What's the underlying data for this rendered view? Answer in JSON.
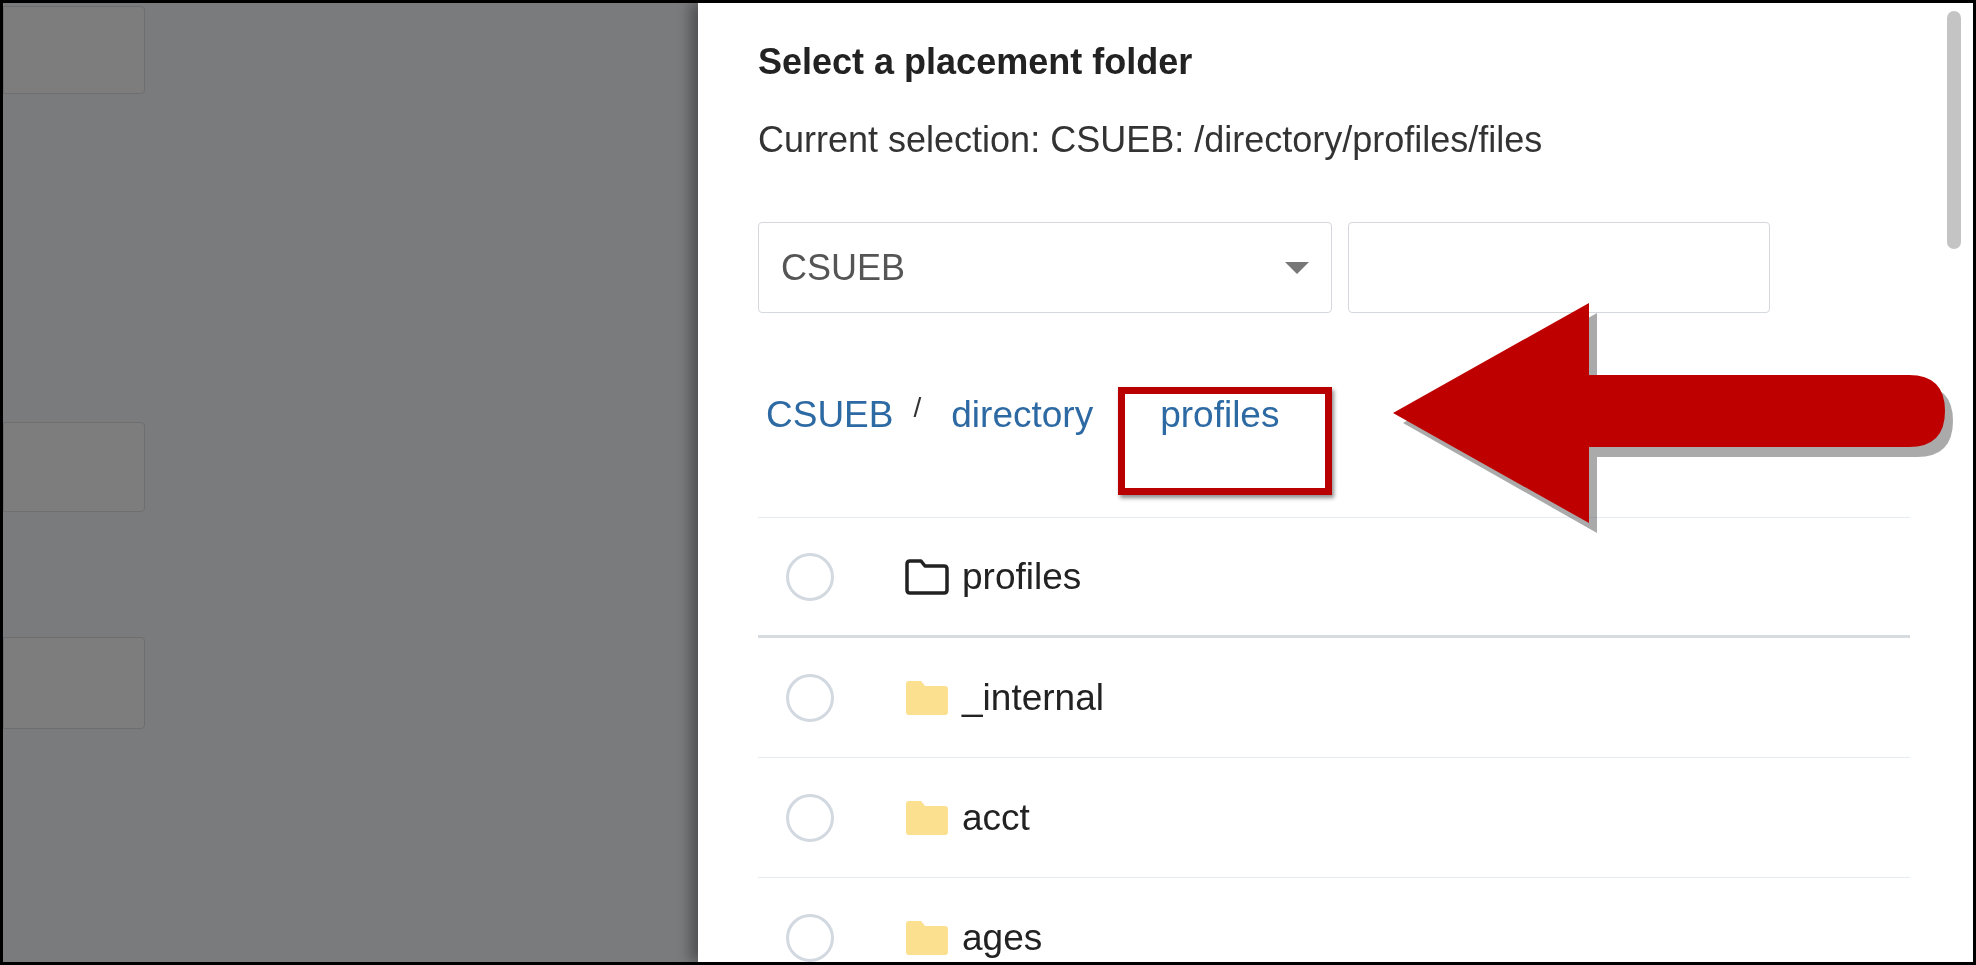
{
  "dialog": {
    "title": "Select a placement folder",
    "current_selection": "Current selection: CSUEB: /directory/profiles/files"
  },
  "site_select": {
    "value": "CSUEB"
  },
  "breadcrumb": [
    {
      "label": "CSUEB",
      "separator": "/",
      "highlighted": false
    },
    {
      "label": "directory",
      "highlighted": false
    },
    {
      "label": "profiles",
      "highlighted": true
    }
  ],
  "folders": [
    {
      "name": "profiles",
      "kind": "current",
      "selected": false
    },
    {
      "name": "_internal",
      "kind": "folder",
      "selected": false
    },
    {
      "name": "acct",
      "kind": "folder",
      "selected": false
    },
    {
      "name": "ages",
      "kind": "folder",
      "selected": false
    }
  ]
}
